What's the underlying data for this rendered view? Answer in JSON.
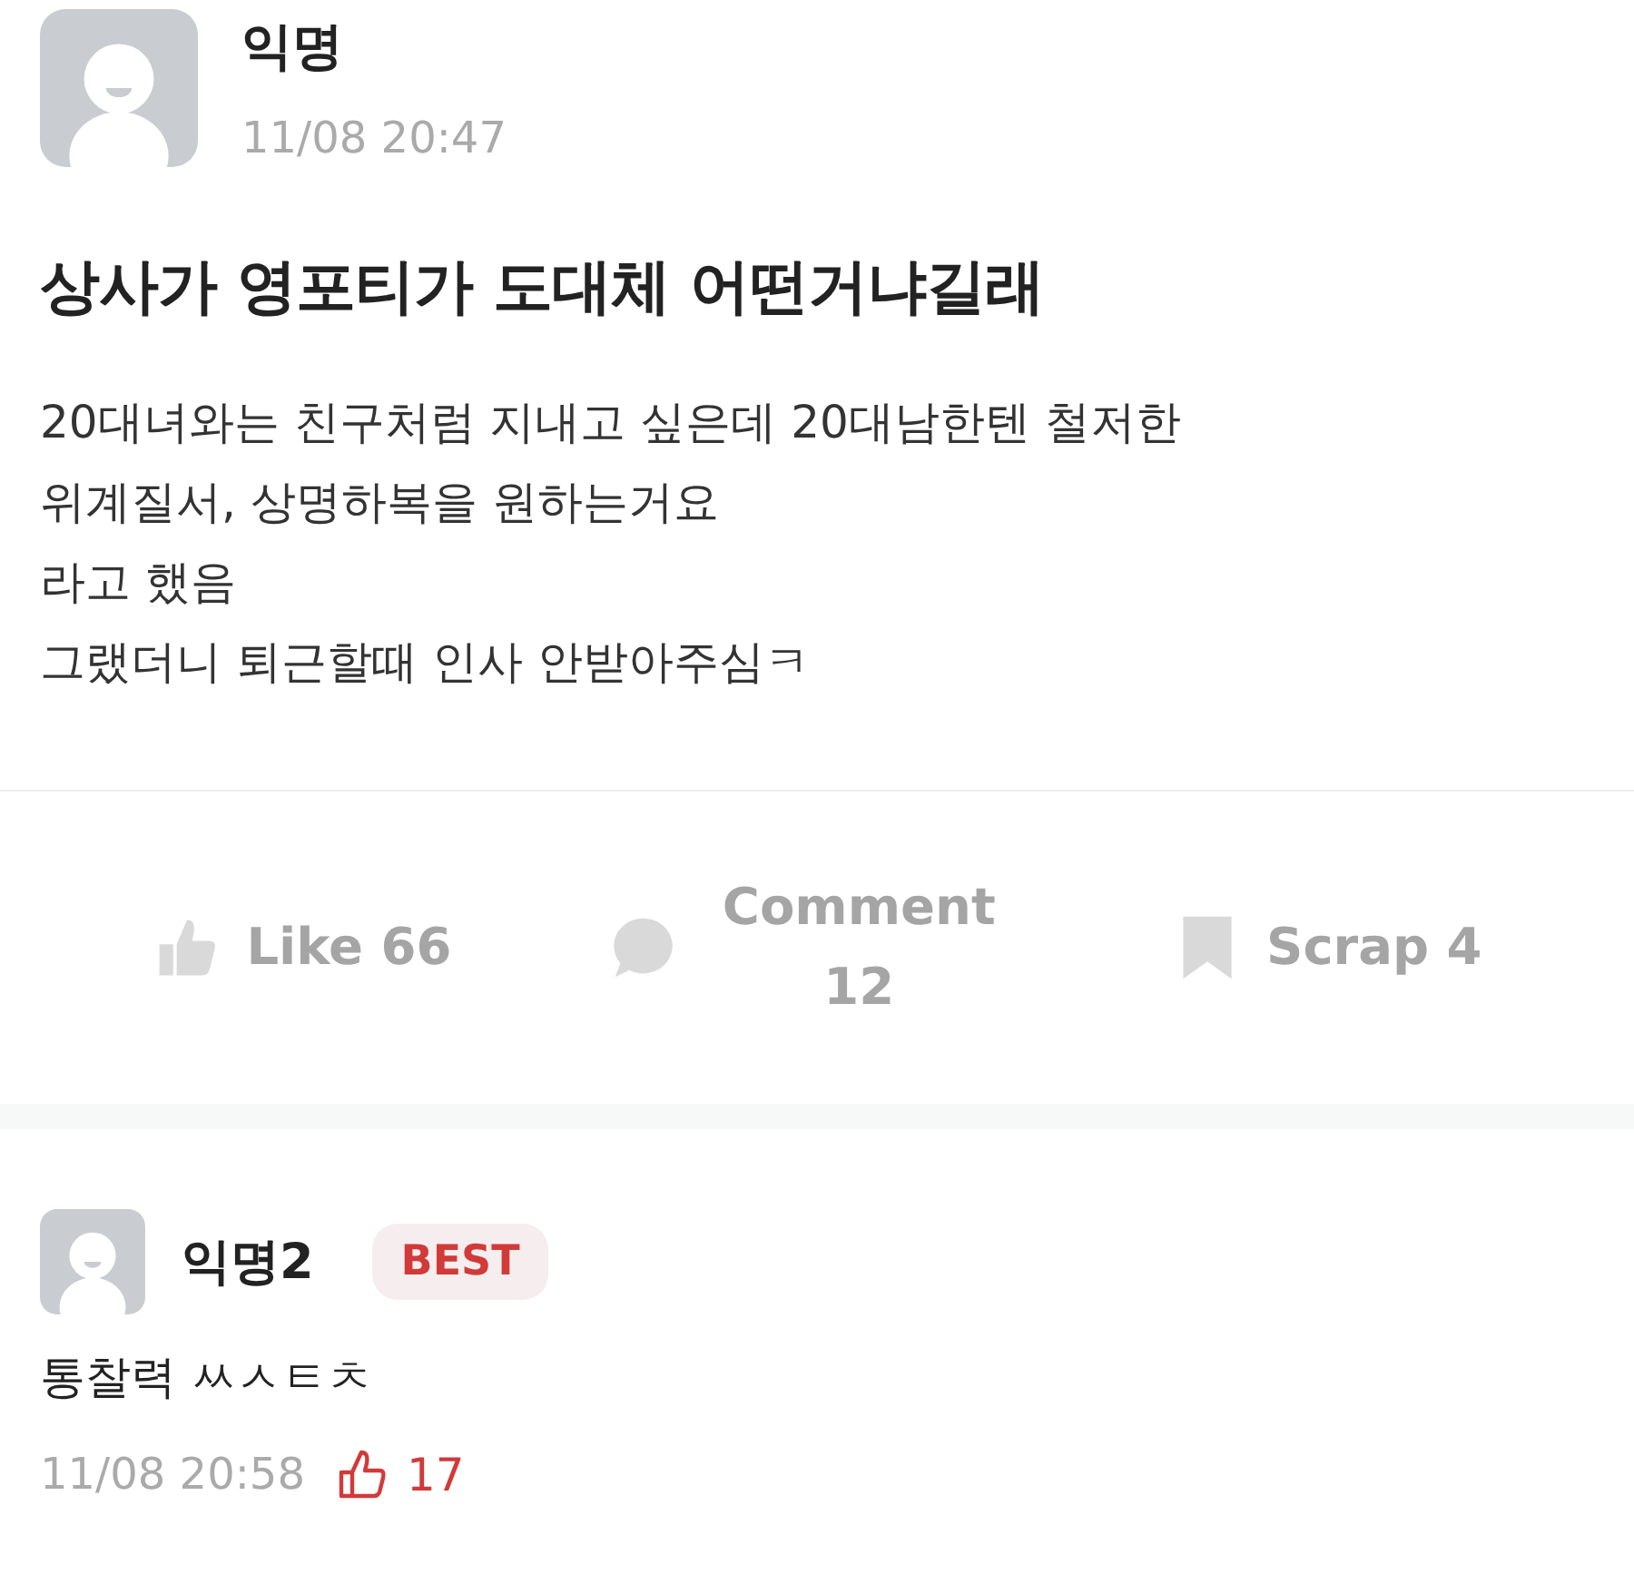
{
  "post": {
    "author": "익명",
    "time": "11/08 20:47",
    "title": "상사가 영포티가 도대체 어떤거냐길래",
    "body": [
      "20대녀와는 친구처럼 지내고 싶은데 20대남한텐 철저한",
      "위계질서, 상명하복을 원하는거요",
      "라고 했음",
      "그랬더니 퇴근할때 인사 안받아주심ㅋ"
    ]
  },
  "actions": [
    {
      "kind": "like",
      "label": "Like 66"
    },
    {
      "kind": "comment",
      "label": "Comment 12"
    },
    {
      "kind": "scrap",
      "label": "Scrap 4"
    }
  ],
  "comments": [
    {
      "author": "익명2",
      "badge": "BEST",
      "text": "통찰력 ㅆㅅㅌㅊ",
      "time": "11/08 20:58",
      "likes": "17"
    }
  ]
}
